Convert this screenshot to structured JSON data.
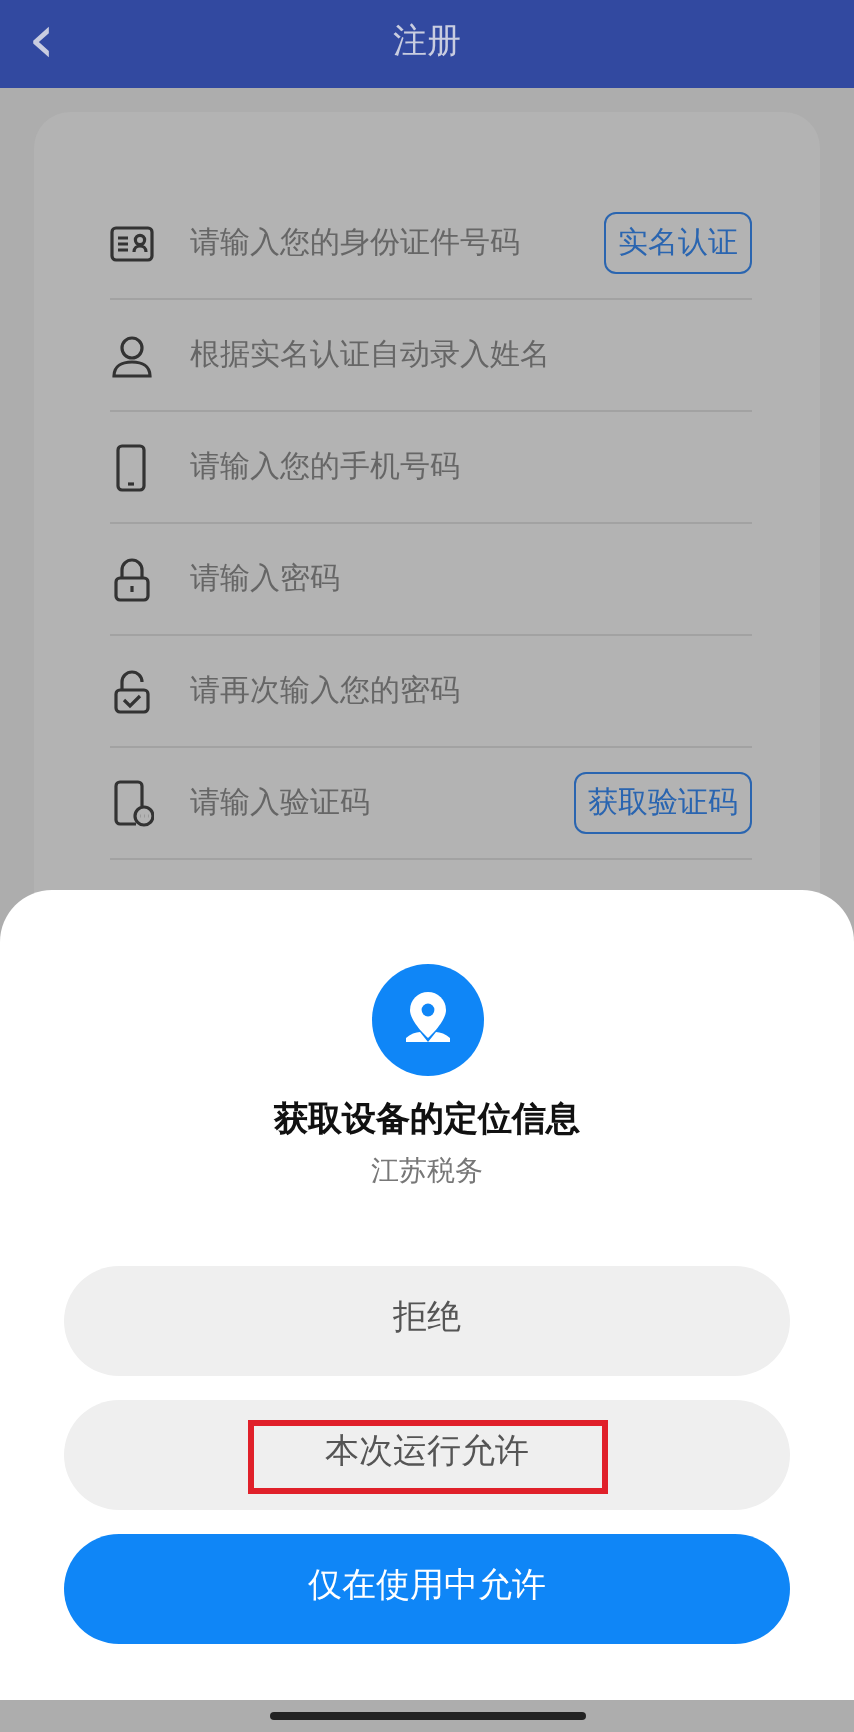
{
  "header": {
    "back": "‹",
    "title": "注册"
  },
  "fields": [
    {
      "kind": "id-card",
      "placeholder": "请输入您的身份证件号码",
      "action": "实名认证"
    },
    {
      "kind": "person",
      "placeholder": "根据实名认证自动录入姓名"
    },
    {
      "kind": "phone",
      "placeholder": "请输入您的手机号码"
    },
    {
      "kind": "lock",
      "placeholder": "请输入密码"
    },
    {
      "kind": "lock-check",
      "placeholder": "请再次输入您的密码"
    },
    {
      "kind": "phone-chat",
      "placeholder": "请输入验证码",
      "action": "获取验证码"
    }
  ],
  "dialog": {
    "title": "获取设备的定位信息",
    "app": "江苏税务",
    "buttons": [
      {
        "label": "拒绝",
        "kind": "secondary",
        "highlighted": false
      },
      {
        "label": "本次运行允许",
        "kind": "secondary",
        "highlighted": true
      },
      {
        "label": "仅在使用中允许",
        "kind": "primary",
        "highlighted": false
      }
    ]
  }
}
